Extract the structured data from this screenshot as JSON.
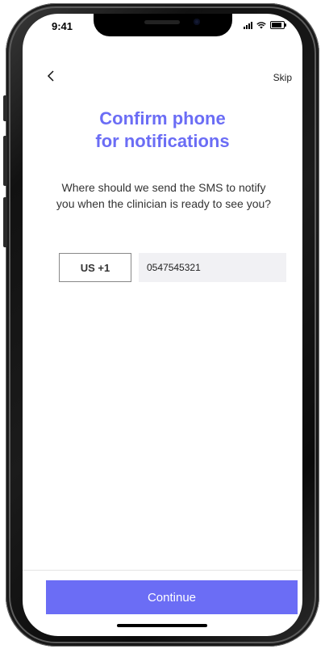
{
  "status_bar": {
    "time": "9:41"
  },
  "nav": {
    "back_icon": "chevron-left-icon",
    "skip_label": "Skip"
  },
  "title": {
    "line1": "Confirm phone",
    "line2": "for notifications"
  },
  "description": "Where should we send the SMS to notify you when the clinician is ready to see you?",
  "phone_form": {
    "country_code": "US +1",
    "phone_value": "0547545321"
  },
  "continue_label": "Continue",
  "colors": {
    "accent": "#6b6df5",
    "input_bg": "#f1f1f4"
  }
}
